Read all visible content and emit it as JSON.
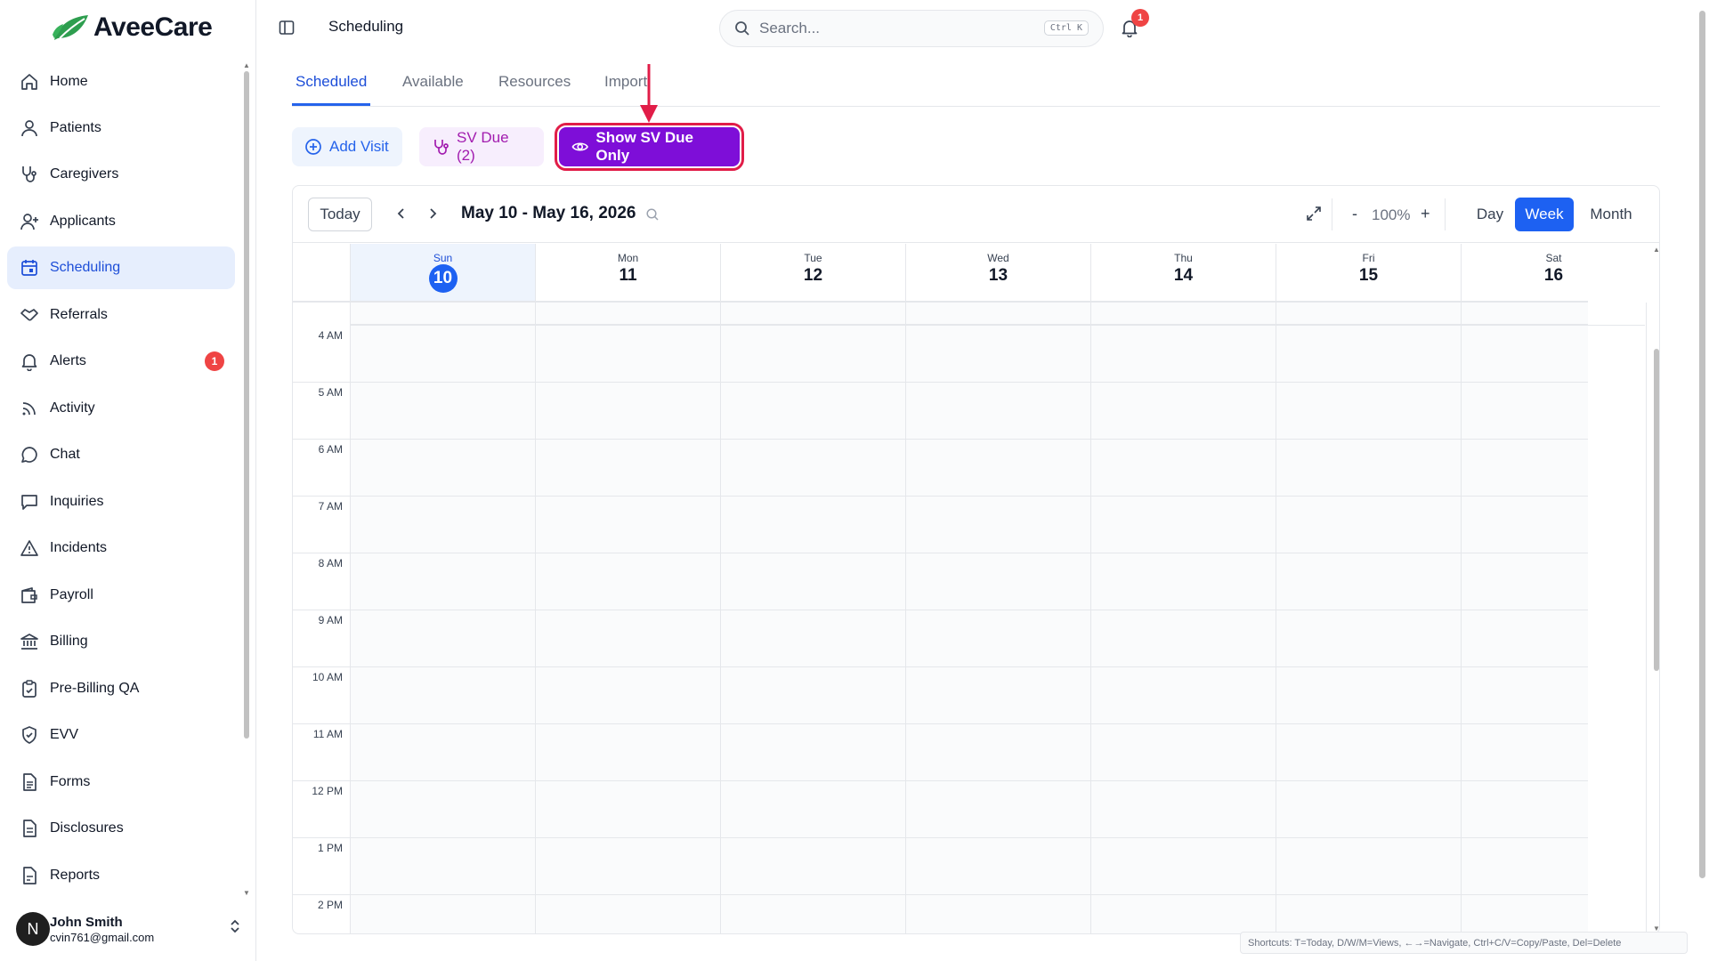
{
  "app": {
    "name": "AveeCare"
  },
  "sidebar": {
    "items": [
      {
        "label": "Home",
        "icon": "home-icon"
      },
      {
        "label": "Patients",
        "icon": "user-icon"
      },
      {
        "label": "Caregivers",
        "icon": "stethoscope-icon"
      },
      {
        "label": "Applicants",
        "icon": "user-plus-icon"
      },
      {
        "label": "Scheduling",
        "icon": "calendar-icon",
        "active": true
      },
      {
        "label": "Referrals",
        "icon": "handshake-icon"
      },
      {
        "label": "Alerts",
        "icon": "bell-icon",
        "badge": "1"
      },
      {
        "label": "Activity",
        "icon": "rss-icon"
      },
      {
        "label": "Chat",
        "icon": "chat-icon"
      },
      {
        "label": "Inquiries",
        "icon": "message-square-icon"
      },
      {
        "label": "Incidents",
        "icon": "warning-icon"
      },
      {
        "label": "Payroll",
        "icon": "wallet-icon"
      },
      {
        "label": "Billing",
        "icon": "bank-icon"
      },
      {
        "label": "Pre-Billing QA",
        "icon": "clipboard-check-icon"
      },
      {
        "label": "EVV",
        "icon": "shield-check-icon"
      },
      {
        "label": "Forms",
        "icon": "file-text-icon"
      },
      {
        "label": "Disclosures",
        "icon": "file-icon"
      },
      {
        "label": "Reports",
        "icon": "report-icon"
      }
    ],
    "user": {
      "initial": "N",
      "name": "John Smith",
      "email": "cvin761@gmail.com"
    }
  },
  "header": {
    "title": "Scheduling",
    "search_placeholder": "Search...",
    "search_shortcut": "Ctrl K",
    "notification_count": "1"
  },
  "tabs": [
    "Scheduled",
    "Available",
    "Resources",
    "Import"
  ],
  "actions": {
    "add_visit": "Add Visit",
    "sv_due": "SV Due (2)",
    "show_sv_due": "Show SV Due Only"
  },
  "calendar": {
    "today_label": "Today",
    "prev": "‹",
    "next": "›",
    "range": "May 10 - May 16, 2026",
    "zoom_minus": "-",
    "zoom": "100%",
    "zoom_plus": "+",
    "views": [
      "Day",
      "Week",
      "Month"
    ],
    "active_view": "Week",
    "days": [
      {
        "name": "Sun",
        "num": "10",
        "today": true
      },
      {
        "name": "Mon",
        "num": "11"
      },
      {
        "name": "Tue",
        "num": "12"
      },
      {
        "name": "Wed",
        "num": "13"
      },
      {
        "name": "Thu",
        "num": "14"
      },
      {
        "name": "Fri",
        "num": "15"
      },
      {
        "name": "Sat",
        "num": "16"
      }
    ],
    "hours": [
      "4 AM",
      "5 AM",
      "6 AM",
      "7 AM",
      "8 AM",
      "9 AM",
      "10 AM",
      "11 AM",
      "12 PM",
      "1 PM",
      "2 PM"
    ]
  },
  "shortcuts": "Shortcuts: T=Today, D/W/M=Views, ←→=Navigate, Ctrl+C/V=Copy/Paste, Del=Delete",
  "colors": {
    "primary": "#1d61f2",
    "accent_purple": "#7e0ed8",
    "highlight": "#e11d48",
    "badge": "#ef4444"
  }
}
